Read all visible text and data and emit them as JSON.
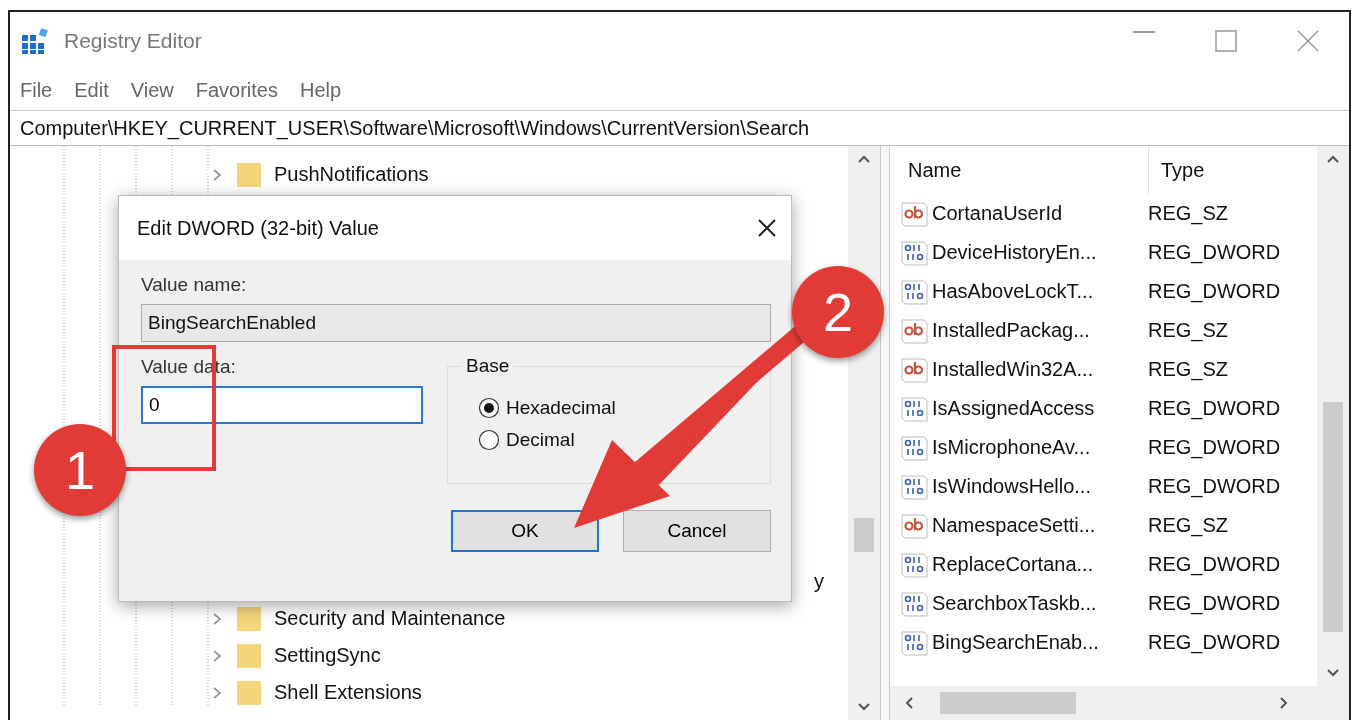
{
  "window": {
    "title": "Registry Editor"
  },
  "menu": [
    "File",
    "Edit",
    "View",
    "Favorites",
    "Help"
  ],
  "address": "Computer\\HKEY_CURRENT_USER\\Software\\Microsoft\\Windows\\CurrentVersion\\Search",
  "tree": {
    "items": [
      {
        "label": "PushNotifications",
        "kind": "full",
        "expanded": false
      },
      {
        "label": "y",
        "kind": "partial"
      },
      {
        "label": "Security and Maintenance",
        "kind": "full",
        "expanded": false
      },
      {
        "label": "SettingSync",
        "kind": "full",
        "expanded": false
      },
      {
        "label": "Shell Extensions",
        "kind": "full",
        "expanded": false
      }
    ]
  },
  "values": {
    "columns": [
      "Name",
      "Type"
    ],
    "rows": [
      {
        "kind": "sz",
        "name": "CortanaUserId",
        "type": "REG_SZ"
      },
      {
        "kind": "dword",
        "name": "DeviceHistoryEn...",
        "type": "REG_DWORD"
      },
      {
        "kind": "dword",
        "name": "HasAboveLockT...",
        "type": "REG_DWORD"
      },
      {
        "kind": "sz",
        "name": "InstalledPackag...",
        "type": "REG_SZ"
      },
      {
        "kind": "sz",
        "name": "InstalledWin32A...",
        "type": "REG_SZ"
      },
      {
        "kind": "dword",
        "name": "IsAssignedAccess",
        "type": "REG_DWORD"
      },
      {
        "kind": "dword",
        "name": "IsMicrophoneAv...",
        "type": "REG_DWORD"
      },
      {
        "kind": "dword",
        "name": "IsWindowsHello...",
        "type": "REG_DWORD"
      },
      {
        "kind": "sz",
        "name": "NamespaceSetti...",
        "type": "REG_SZ"
      },
      {
        "kind": "dword",
        "name": "ReplaceCortana...",
        "type": "REG_DWORD"
      },
      {
        "kind": "dword",
        "name": "SearchboxTaskb...",
        "type": "REG_DWORD"
      },
      {
        "kind": "dword",
        "name": "BingSearchEnab...",
        "type": "REG_DWORD"
      }
    ]
  },
  "dialog": {
    "title": "Edit DWORD (32-bit) Value",
    "value_name_label": "Value name:",
    "value_name": "BingSearchEnabled",
    "value_data_label": "Value data:",
    "value_data": "0",
    "base_label": "Base",
    "base_options": [
      {
        "label": "Hexadecimal",
        "selected": true
      },
      {
        "label": "Decimal",
        "selected": false
      }
    ],
    "buttons": [
      {
        "label": "OK",
        "default": true
      },
      {
        "label": "Cancel",
        "default": false
      }
    ]
  },
  "annotations": [
    {
      "label": "1"
    },
    {
      "label": "2"
    }
  ]
}
